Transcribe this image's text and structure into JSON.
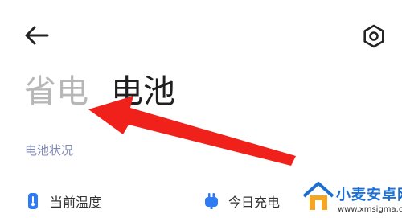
{
  "header": {
    "back_icon": "arrow-left-icon",
    "settings_icon": "hexagon-gear-icon"
  },
  "tabs": [
    {
      "label": "省电",
      "active": false
    },
    {
      "label": "电池",
      "active": true
    }
  ],
  "section": {
    "title": "电池状况"
  },
  "stats": [
    {
      "label": "当前温度",
      "icon": "thermometer-icon"
    },
    {
      "label": "今日充电",
      "icon": "plug-icon"
    }
  ],
  "colors": {
    "accent": "#2f7bf5",
    "annotation_arrow": "#f0201b",
    "section_title": "#7f88b3"
  },
  "watermark": {
    "name": "小麦安卓网",
    "url": "www.xmsigma.com"
  }
}
